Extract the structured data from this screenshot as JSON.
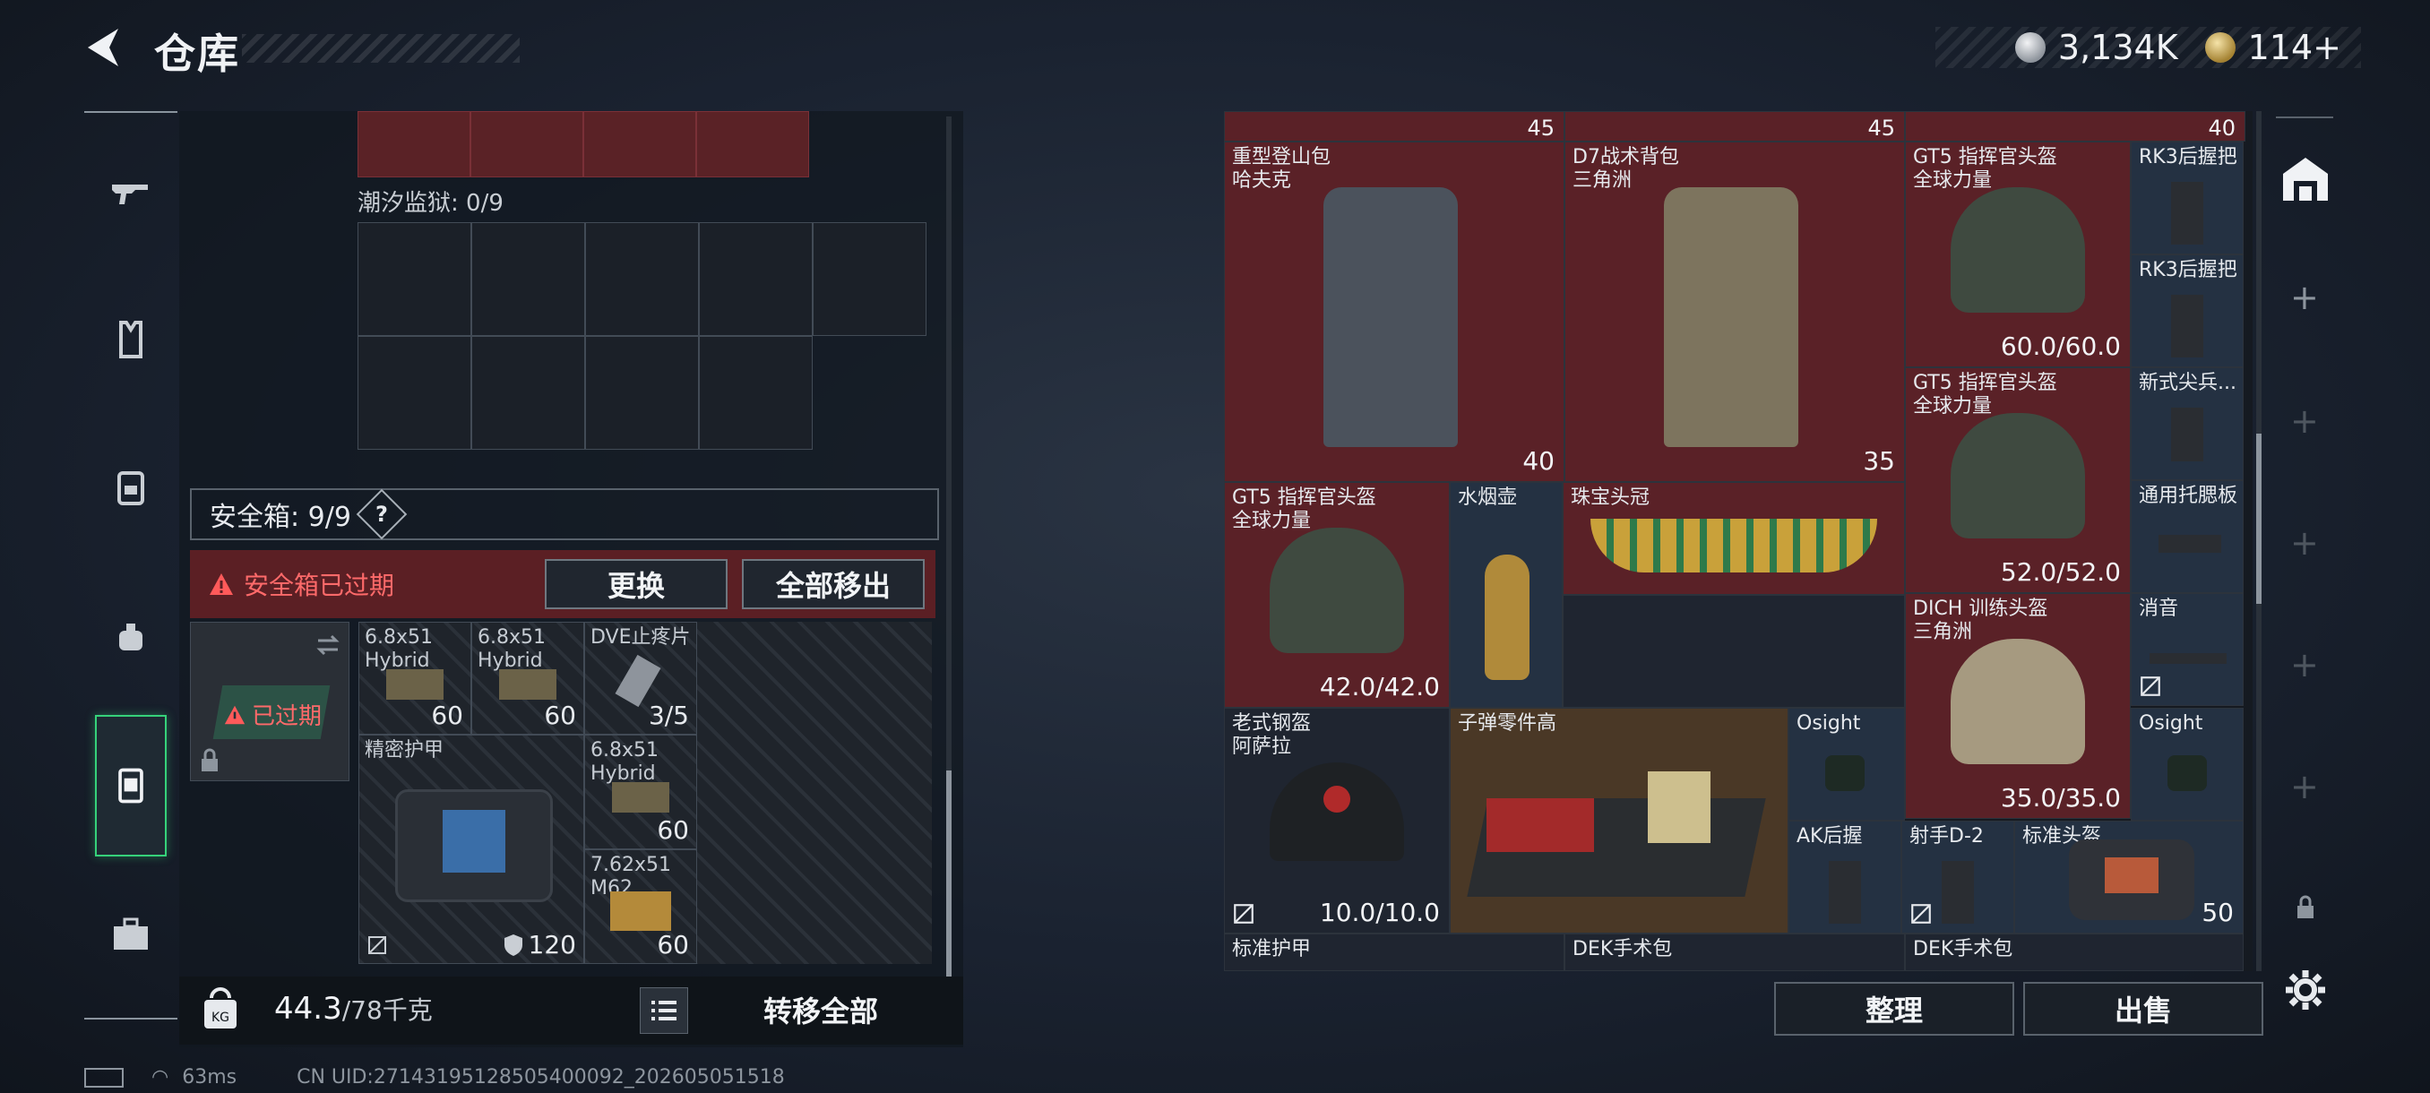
{
  "header": {
    "title": "仓库",
    "currency": [
      {
        "icon": "silver-coin-icon",
        "value": "3,134K"
      },
      {
        "icon": "gold-coin-icon",
        "value": "114+"
      }
    ]
  },
  "rail": {
    "items": [
      "gun-icon",
      "vest-icon",
      "backpack-icon",
      "pouch-icon",
      "safebox-icon",
      "toolbox-icon"
    ],
    "active": "safebox-icon"
  },
  "left": {
    "tide_prison": "潮汐监狱: 0/9",
    "safebox": {
      "label": "安全箱: 9/9",
      "help": "?"
    },
    "expired_banner": "安全箱已过期",
    "replace_btn": "更换",
    "move_all_btn": "全部移出",
    "box_status": "已过期",
    "items": [
      {
        "name": "6.8x51\nHybrid",
        "count": "60"
      },
      {
        "name": "6.8x51\nHybrid",
        "count": "60"
      },
      {
        "name": "DVE止疼片",
        "count": "3/5"
      },
      {
        "name": "精密护甲",
        "count": "120"
      },
      {
        "name": "6.8x51\nHybrid",
        "count": "60"
      },
      {
        "name": "7.62x51\nM62",
        "count": "60"
      }
    ],
    "weight_current": "44.3",
    "weight_max": "/78千克",
    "transfer_all": "转移全部"
  },
  "right": {
    "top_counts": [
      "45",
      "45",
      "40"
    ],
    "items": [
      {
        "name": "重型登山包\n哈夫克",
        "value": "40"
      },
      {
        "name": "D7战术背包\n三角洲",
        "value": "35"
      },
      {
        "name": "GT5 指挥官头盔\n全球力量",
        "value": "60.0/60.0"
      },
      {
        "name": "RK3后握把",
        "value": ""
      },
      {
        "name": "RK3后握把",
        "value": ""
      },
      {
        "name": "GT5 指挥官头盔\n全球力量",
        "value": "52.0/52.0"
      },
      {
        "name": "新式尖兵...",
        "value": ""
      },
      {
        "name": "GT5 指挥官头盔\n全球力量",
        "value": "42.0/42.0"
      },
      {
        "name": "水烟壶",
        "value": ""
      },
      {
        "name": "珠宝头冠",
        "value": ""
      },
      {
        "name": "通用托腮板",
        "value": ""
      },
      {
        "name": "DICH 训练头盔\n三角洲",
        "value": "35.0/35.0"
      },
      {
        "name": "消音",
        "value": ""
      },
      {
        "name": "老式钢盔\n阿萨拉",
        "value": "10.0/10.0"
      },
      {
        "name": "子弹零件高",
        "value": ""
      },
      {
        "name": "Osight",
        "value": ""
      },
      {
        "name": "Osight",
        "value": ""
      },
      {
        "name": "AK后握",
        "value": ""
      },
      {
        "name": "射手D-2",
        "value": ""
      },
      {
        "name": "标准头盔",
        "value": "50"
      },
      {
        "name": "标准护甲",
        "value": ""
      },
      {
        "name": "DEK手术包",
        "value": ""
      },
      {
        "name": "DEK手术包",
        "value": ""
      }
    ],
    "sort_btn": "整理",
    "sell_btn": "出售"
  },
  "status": {
    "ping": "63ms",
    "uid": "CN UID:27143195128505400092_202605051518"
  }
}
